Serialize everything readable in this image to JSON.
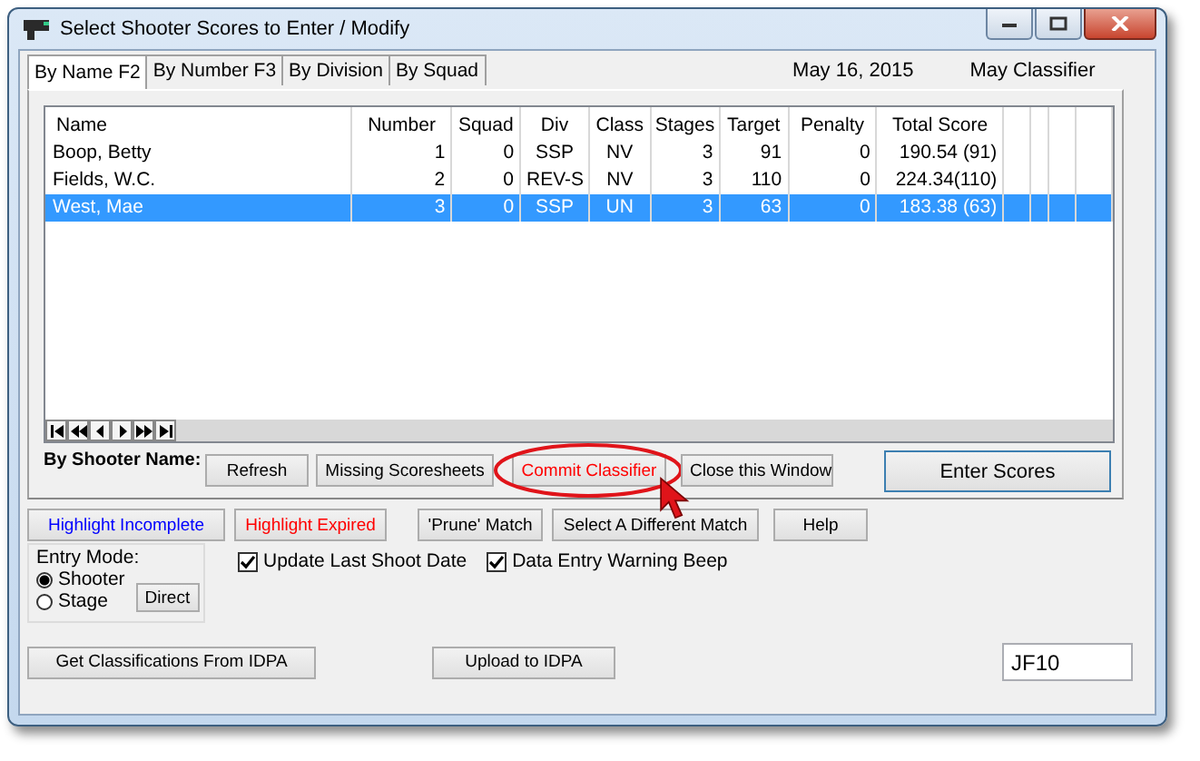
{
  "window": {
    "title": "Select Shooter Scores to Enter / Modify"
  },
  "tabs": [
    {
      "label": "By Name F2",
      "selected": true
    },
    {
      "label": "By Number F3",
      "selected": false
    },
    {
      "label": "By Division",
      "selected": false
    },
    {
      "label": "By Squad",
      "selected": false
    }
  ],
  "match_date": "May 16, 2015",
  "match_name": "May Classifier",
  "table": {
    "columns": [
      "Name",
      "Number",
      "Squad",
      "Div",
      "Class",
      "Stages",
      "Target",
      "Penalty",
      "Total Score"
    ],
    "rows": [
      {
        "cells": [
          "Boop, Betty",
          "1",
          "0",
          "SSP",
          "NV",
          "3",
          "91",
          "0",
          "190.54 (91)"
        ],
        "selected": false
      },
      {
        "cells": [
          "Fields, W.C.",
          "2",
          "0",
          "REV-S",
          "NV",
          "3",
          "110",
          "0",
          "224.34(110)"
        ],
        "selected": false
      },
      {
        "cells": [
          "West, Mae",
          "3",
          "0",
          "SSP",
          "UN",
          "3",
          "63",
          "0",
          "183.38 (63)"
        ],
        "selected": true
      }
    ]
  },
  "navigator": [
    {
      "kind": "first"
    },
    {
      "kind": "prev-page"
    },
    {
      "kind": "prev"
    },
    {
      "kind": "next"
    },
    {
      "kind": "next-page"
    },
    {
      "kind": "last"
    }
  ],
  "list_label": "By Shooter Name:",
  "list_buttons": [
    {
      "label": "Refresh",
      "color": "#000000",
      "highlighted": false
    },
    {
      "label": "Missing Scoresheets",
      "color": "#000000",
      "highlighted": false
    },
    {
      "label": "Commit Classifier",
      "color": "#ff0000",
      "highlighted": true
    },
    {
      "label": "Close this Window",
      "color": "#000000",
      "highlighted": false
    }
  ],
  "enter_button": "Enter Scores",
  "action_buttons": [
    {
      "label": "Highlight Incomplete",
      "color": "#0000ff"
    },
    {
      "label": "Highlight Expired",
      "color": "#ff0000"
    },
    {
      "label": "'Prune' Match",
      "color": "#000000"
    },
    {
      "label": "Select A Different  Match",
      "color": "#000000"
    },
    {
      "label": "Help",
      "color": "#000000"
    }
  ],
  "entry_mode": {
    "label": "Entry Mode:",
    "options": [
      {
        "label": "Shooter",
        "selected": true
      },
      {
        "label": "Stage",
        "selected": false
      }
    ],
    "button": "Direct"
  },
  "checkboxes": [
    {
      "label": "Update Last Shoot Date",
      "checked": true
    },
    {
      "label": "Data Entry Warning Beep",
      "checked": true
    }
  ],
  "bottom_buttons": [
    "Get Classifications From IDPA",
    "Upload to IDPA"
  ],
  "code_field": {
    "value": "JF10"
  }
}
